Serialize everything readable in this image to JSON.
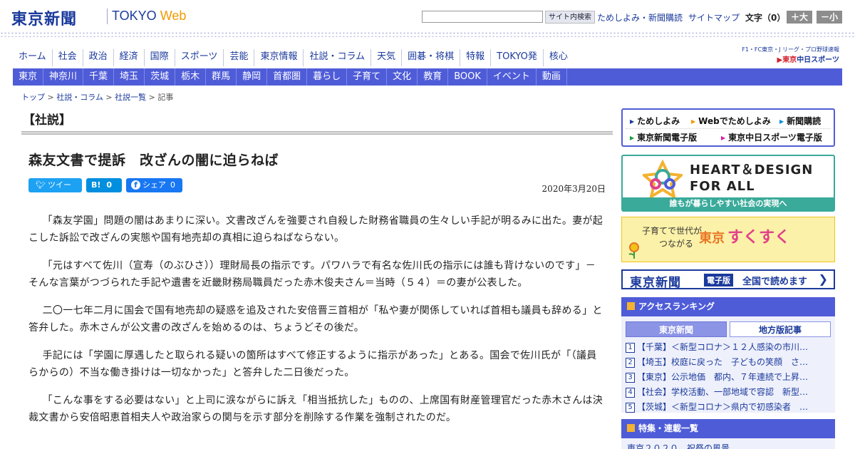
{
  "header": {
    "logo_jp": "東京新聞",
    "logo_en_prefix": "TOKYO ",
    "logo_en_suffix": "Web",
    "search_value": "",
    "search_button": "サイト内検索",
    "link_subscribe": "ためしよみ・新聞購読",
    "link_sitemap": "サイトマップ",
    "font_size_label": "文字（0）",
    "font_up": "＋大",
    "font_down": "－小"
  },
  "main_nav": [
    "ホーム",
    "社会",
    "政治",
    "経済",
    "国際",
    "スポーツ",
    "芸能",
    "東京情報",
    "社説・コラム",
    "天気",
    "囲碁・将棋",
    "特報",
    "TOKYO発",
    "核心"
  ],
  "sports_banner": {
    "line1": "F1・FC東京・J リーグ・プロ野球速報",
    "line2_prefix": "▶東京",
    "line2_main": "中日スポーツ"
  },
  "area_nav": [
    "東京",
    "神奈川",
    "千葉",
    "埼玉",
    "茨城",
    "栃木",
    "群馬",
    "静岡",
    "首都圏",
    "暮らし",
    "子育て",
    "文化",
    "教育",
    "BOOK",
    "イベント",
    "動画"
  ],
  "breadcrumb": {
    "items": [
      "トップ",
      "社説・コラム",
      "社説一覧"
    ],
    "current": "記事",
    "sep": " > "
  },
  "article": {
    "section": "【社説】",
    "headline": "森友文書で提訴　改ざんの闇に迫らねば",
    "tweet_label": "ツイート",
    "hatena_label": "B!",
    "hatena_count": "0",
    "fb_label": "シェア",
    "fb_count": "0",
    "date": "2020年3月20日",
    "paragraphs": [
      "「森友学園」問題の闇はあまりに深い。文書改ざんを強要され自殺した財務省職員の生々しい手記が明るみに出た。妻が起こした訴訟で改ざんの実態や国有地売却の真相に迫らねばならない。",
      "「元はすべて佐川（宣寿（のぶひさ））理財局長の指示です。パワハラで有名な佐川氏の指示には誰も背けないのです」－そんな言葉がつづられた手記や遺書を近畿財務局職員だった赤木俊夫さん＝当時（５４）＝の妻が公表した。",
      "二〇一七年二月に国会で国有地売却の疑惑を追及された安倍晋三首相が「私や妻が関係していれば首相も議員も辞める」と答弁した。赤木さんが公文書の改ざんを始めるのは、ちょうどその後だ。",
      "手記には「学園に厚遇したと取られる疑いの箇所はすべて修正するように指示があった」とある。国会で佐川氏が「（議員らからの）不当な働き掛けは一切なかった」と答弁した二日後だった。",
      "「こんな事をする必要はない」と上司に涙ながらに訴え「相当抵抗した」ものの、上席国有財産管理官だった赤木さんは決裁文書から安倍昭恵首相夫人や政治家らの関与を示す部分を削除する作業を強制されたのだ。"
    ]
  },
  "sidebar": {
    "links": [
      "ためしよみ",
      "Webでためしよみ",
      "新聞購読",
      "東京新聞電子版",
      "東京中日スポーツ電子版"
    ],
    "heart_design": {
      "title_line1": "HEART＆DESIGN",
      "title_line2": "FOR ALL",
      "subtitle": "誰もが暮らしやすい社会の実現へ"
    },
    "sukusuku": {
      "line1": "子育てで世代が",
      "line2": "つながる",
      "brand_prefix": "東京",
      "brand": "すくすく"
    },
    "digital": {
      "logo": "東京新聞",
      "tag": "電子版",
      "text": "全国で読めます",
      "arrow": "❯"
    },
    "ranking": {
      "title": "アクセスランキング",
      "tab_active": "東京新聞",
      "tab_inactive": "地方版記事",
      "items": [
        "【千葉】＜新型コロナ＞１２人感染の市川…",
        "【埼玉】校庭に戻った　子どもの笑顔　さ…",
        "【東京】公示地価　都内、７年連続で上昇…",
        "【社会】学校活動、一部地域で容認　新型…",
        "【茨城】＜新型コロナ＞県内で初感染者　…"
      ]
    },
    "features": {
      "title": "特集・連載一覧",
      "item": "東京２０２０　祝祭の風景"
    }
  },
  "colors": {
    "brand": "#1b3a9c",
    "nav_bg": "#4f5cd8",
    "accent": "#f39800",
    "hd_green": "#3aaa9a"
  }
}
